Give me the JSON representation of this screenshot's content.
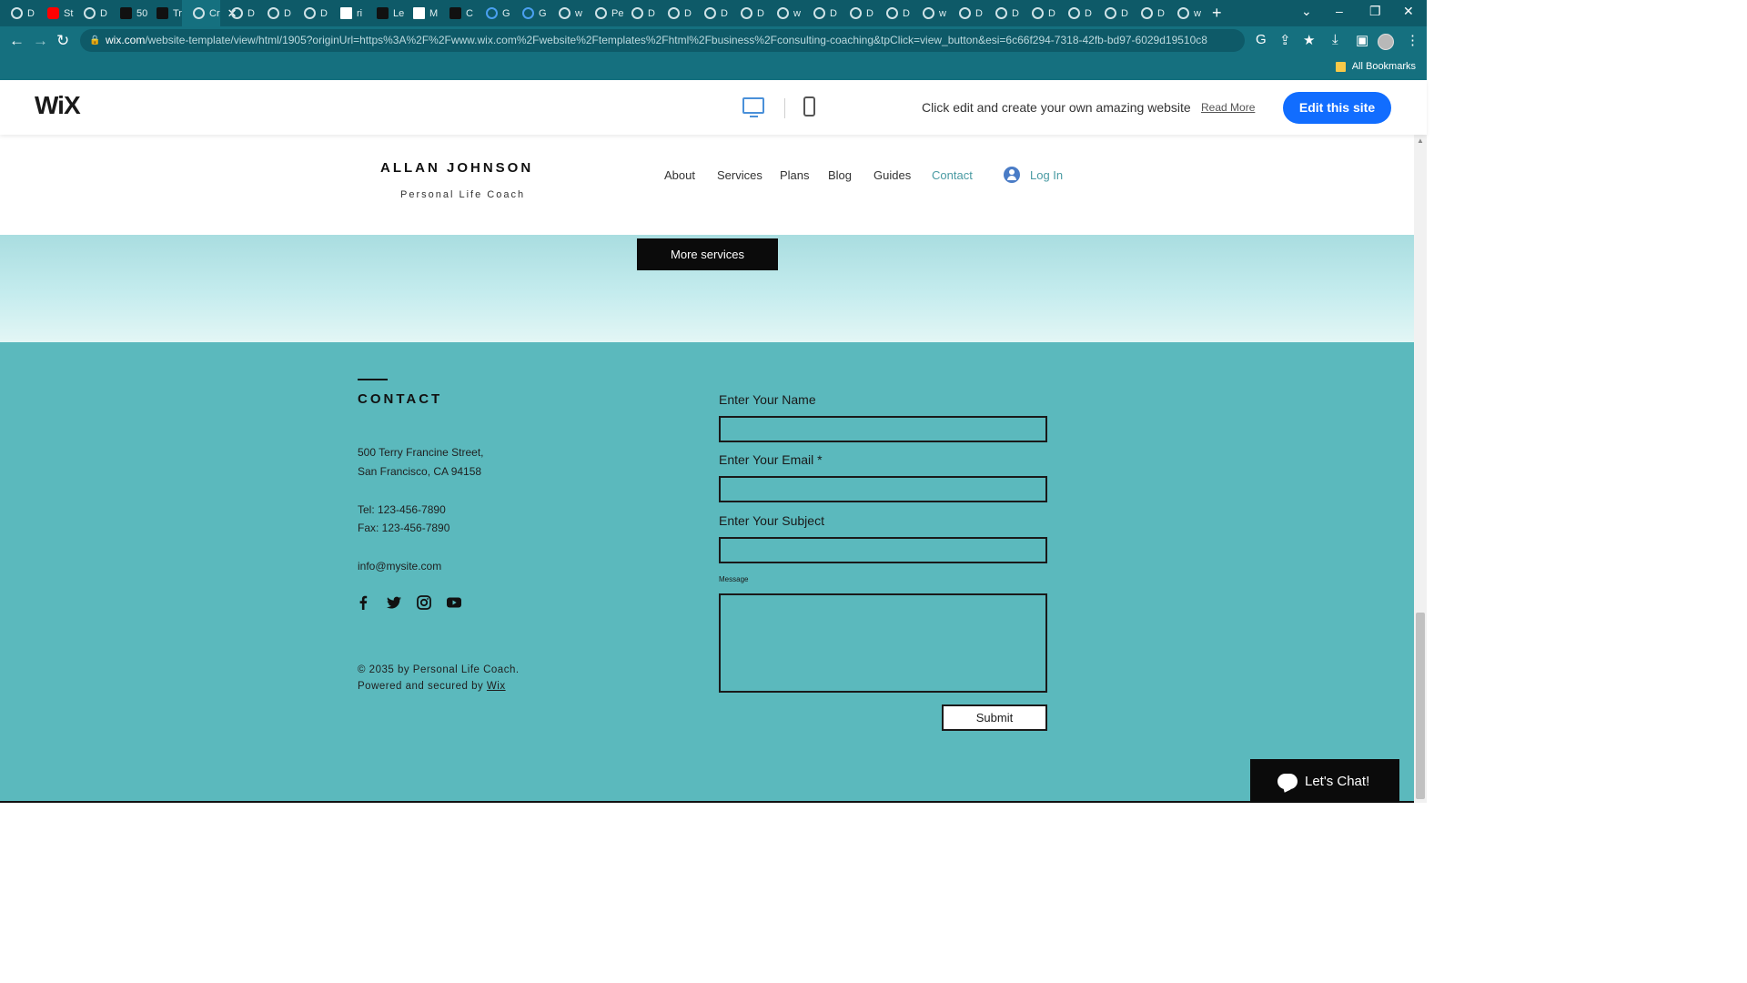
{
  "browser": {
    "tabs": [
      {
        "label": "D",
        "icon": "globe-icon"
      },
      {
        "label": "St",
        "icon": "youtube-icon"
      },
      {
        "label": "D",
        "icon": "globe-icon"
      },
      {
        "label": "50",
        "icon": "app-icon"
      },
      {
        "label": "Tr",
        "icon": "app-icon"
      },
      {
        "label": "Cr",
        "icon": "globe-icon",
        "active": true
      },
      {
        "label": "D",
        "icon": "globe-icon"
      },
      {
        "label": "D",
        "icon": "globe-icon"
      },
      {
        "label": "D",
        "icon": "globe-icon"
      },
      {
        "label": "ri",
        "icon": "doc-icon"
      },
      {
        "label": "Le",
        "icon": "app-icon"
      },
      {
        "label": "M",
        "icon": "doc-icon"
      },
      {
        "label": "C",
        "icon": "wix-icon"
      },
      {
        "label": "G",
        "icon": "google-icon"
      },
      {
        "label": "G",
        "icon": "google-icon"
      },
      {
        "label": "w",
        "icon": "globe-icon"
      },
      {
        "label": "Pe",
        "icon": "globe-icon"
      },
      {
        "label": "D",
        "icon": "globe-icon"
      },
      {
        "label": "D",
        "icon": "globe-icon"
      },
      {
        "label": "D",
        "icon": "globe-icon"
      },
      {
        "label": "D",
        "icon": "globe-icon"
      },
      {
        "label": "w",
        "icon": "globe-icon"
      },
      {
        "label": "D",
        "icon": "globe-icon"
      },
      {
        "label": "D",
        "icon": "globe-icon"
      },
      {
        "label": "D",
        "icon": "globe-icon"
      },
      {
        "label": "w",
        "icon": "globe-icon"
      },
      {
        "label": "D",
        "icon": "globe-icon"
      },
      {
        "label": "D",
        "icon": "globe-icon"
      },
      {
        "label": "D",
        "icon": "globe-icon"
      },
      {
        "label": "D",
        "icon": "globe-icon"
      },
      {
        "label": "D",
        "icon": "globe-icon"
      },
      {
        "label": "D",
        "icon": "globe-icon"
      },
      {
        "label": "w",
        "icon": "globe-icon"
      }
    ],
    "url_host": "wix.com",
    "url_rest": "/website-template/view/html/1905?originUrl=https%3A%2F%2Fwww.wix.com%2Fwebsite%2Ftemplates%2Fhtml%2Fbusiness%2Fconsulting-coaching&tpClick=view_button&esi=6c66f294-7318-42fb-bd97-6029d19510c8",
    "bookmarks_label": "All Bookmarks"
  },
  "wix_bar": {
    "logo": "WiX",
    "message": "Click edit and create your own amazing website",
    "read_more": "Read More",
    "edit_button": "Edit this site"
  },
  "site": {
    "brand_name": "ALLAN JOHNSON",
    "brand_subtitle": "Personal Life Coach",
    "nav": [
      "About",
      "Services",
      "Plans",
      "Blog",
      "Guides",
      "Contact"
    ],
    "nav_active": "Contact",
    "login": "Log In",
    "more_services": "More services"
  },
  "contact": {
    "title": "CONTACT",
    "address_line1": "500 Terry Francine Street,",
    "address_line2": "San Francisco, CA 94158",
    "tel": "Tel: 123-456-7890",
    "fax": "Fax: 123-456-7890",
    "email": "info@mysite.com",
    "social": [
      "facebook-icon",
      "twitter-icon",
      "instagram-icon",
      "youtube-icon"
    ],
    "copyright": "© 2035 by Personal Life Coach.",
    "powered_prefix": "Powered and secured by",
    "powered_link": "Wix",
    "form": {
      "name_label": "Enter Your Name",
      "email_label": "Enter Your Email *",
      "subject_label": "Enter Your Subject",
      "message_label": "Message",
      "submit": "Submit"
    }
  },
  "chat": {
    "label": "Let's Chat!"
  },
  "colors": {
    "contact_bg": "#5bb9bd",
    "accent": "#4a9ba3",
    "wix_blue": "#116dff",
    "browser_dark": "#0e5a68"
  }
}
